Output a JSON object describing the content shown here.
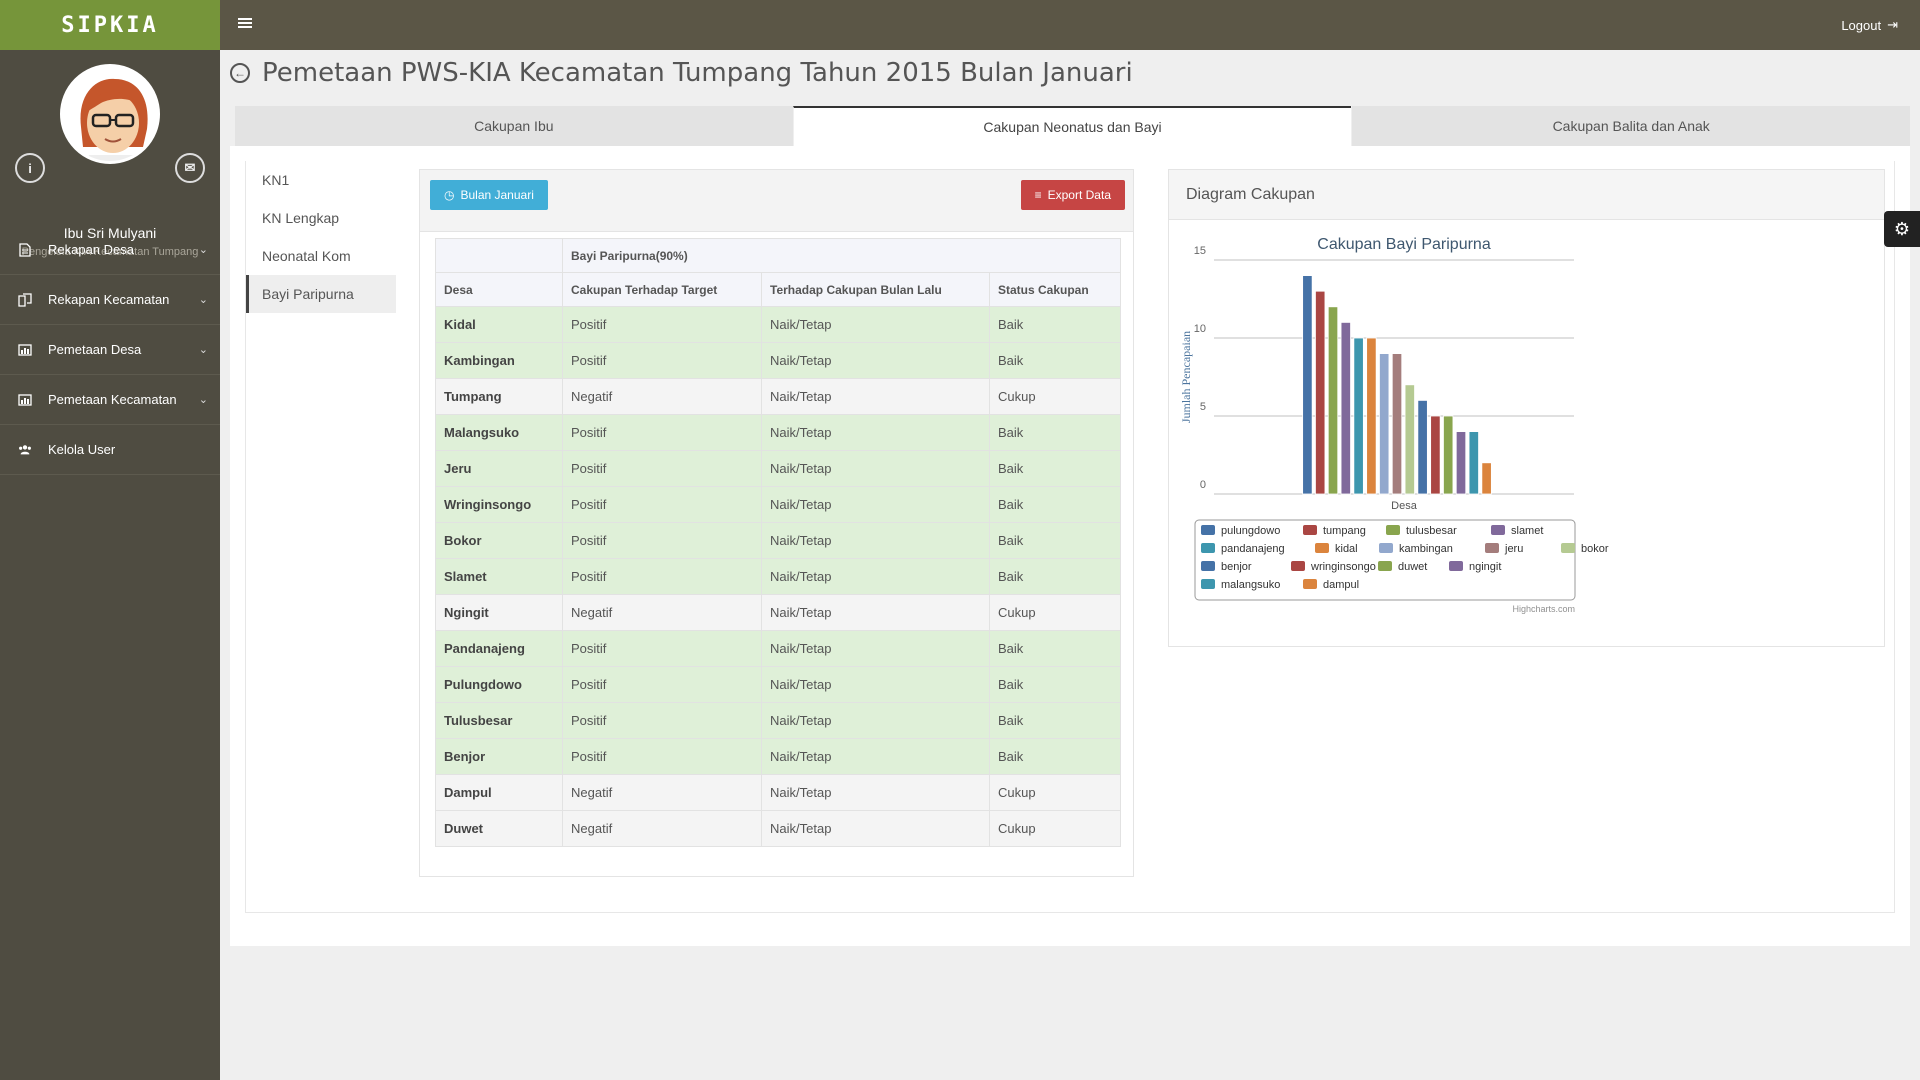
{
  "app": {
    "brand": "SIPKIA",
    "logout_label": "Logout"
  },
  "profile": {
    "name": "Ibu Sri Mulyani",
    "role": "Pengelola KIA Kecamatan Tumpang"
  },
  "menu": [
    {
      "label": "Rekapan Desa",
      "icon": "file-icon",
      "has_children": true
    },
    {
      "label": "Rekapan Kecamatan",
      "icon": "files-icon",
      "has_children": true
    },
    {
      "label": "Pemetaan Desa",
      "icon": "chart-icon",
      "has_children": true
    },
    {
      "label": "Pemetaan Kecamatan",
      "icon": "chart-icon",
      "has_children": true
    },
    {
      "label": "Kelola User",
      "icon": "users-icon",
      "has_children": false
    }
  ],
  "page": {
    "title": "Pemetaan PWS-KIA Kecamatan Tumpang Tahun 2015 Bulan Januari"
  },
  "tabs": [
    {
      "label": "Cakupan Ibu",
      "active": false
    },
    {
      "label": "Cakupan Neonatus dan Bayi",
      "active": true
    },
    {
      "label": "Cakupan Balita dan Anak",
      "active": false
    }
  ],
  "subnav": [
    {
      "label": "KN1",
      "active": false
    },
    {
      "label": "KN Lengkap",
      "active": false
    },
    {
      "label": "Neonatal Kom",
      "active": false
    },
    {
      "label": "Bayi Paripurna",
      "active": true
    }
  ],
  "toolbar": {
    "month_button": "Bulan Januari",
    "export_button": "Export Data"
  },
  "table": {
    "group_header": "Bayi Paripurna(90%)",
    "columns": [
      "Desa",
      "Cakupan Terhadap Target",
      "Terhadap Cakupan Bulan Lalu",
      "Status Cakupan"
    ],
    "rows": [
      {
        "desa": "Kidal",
        "target": "Positif",
        "bulan_lalu": "Naik/Tetap",
        "status": "Baik"
      },
      {
        "desa": "Kambingan",
        "target": "Positif",
        "bulan_lalu": "Naik/Tetap",
        "status": "Baik"
      },
      {
        "desa": "Tumpang",
        "target": "Negatif",
        "bulan_lalu": "Naik/Tetap",
        "status": "Cukup"
      },
      {
        "desa": "Malangsuko",
        "target": "Positif",
        "bulan_lalu": "Naik/Tetap",
        "status": "Baik"
      },
      {
        "desa": "Jeru",
        "target": "Positif",
        "bulan_lalu": "Naik/Tetap",
        "status": "Baik"
      },
      {
        "desa": "Wringinsongo",
        "target": "Positif",
        "bulan_lalu": "Naik/Tetap",
        "status": "Baik"
      },
      {
        "desa": "Bokor",
        "target": "Positif",
        "bulan_lalu": "Naik/Tetap",
        "status": "Baik"
      },
      {
        "desa": "Slamet",
        "target": "Positif",
        "bulan_lalu": "Naik/Tetap",
        "status": "Baik"
      },
      {
        "desa": "Ngingit",
        "target": "Negatif",
        "bulan_lalu": "Naik/Tetap",
        "status": "Cukup"
      },
      {
        "desa": "Pandanajeng",
        "target": "Positif",
        "bulan_lalu": "Naik/Tetap",
        "status": "Baik"
      },
      {
        "desa": "Pulungdowo",
        "target": "Positif",
        "bulan_lalu": "Naik/Tetap",
        "status": "Baik"
      },
      {
        "desa": "Tulusbesar",
        "target": "Positif",
        "bulan_lalu": "Naik/Tetap",
        "status": "Baik"
      },
      {
        "desa": "Benjor",
        "target": "Positif",
        "bulan_lalu": "Naik/Tetap",
        "status": "Baik"
      },
      {
        "desa": "Dampul",
        "target": "Negatif",
        "bulan_lalu": "Naik/Tetap",
        "status": "Cukup"
      },
      {
        "desa": "Duwet",
        "target": "Negatif",
        "bulan_lalu": "Naik/Tetap",
        "status": "Cukup"
      }
    ]
  },
  "chart_panel": {
    "title": "Diagram Cakupan",
    "credits": "Highcharts.com"
  },
  "chart_data": {
    "type": "bar",
    "title": "Cakupan Bayi Paripurna",
    "xlabel": "Desa",
    "ylabel": "Jumlah Pencapaian",
    "ylim": [
      0,
      15
    ],
    "yticks": [
      0,
      5,
      10,
      15
    ],
    "grid": true,
    "legend_position": "bottom",
    "series": [
      {
        "name": "pulungdowo",
        "value": 14,
        "color": "#4572a7"
      },
      {
        "name": "tumpang",
        "value": 13,
        "color": "#aa4643"
      },
      {
        "name": "tulusbesar",
        "value": 12,
        "color": "#89a54e"
      },
      {
        "name": "slamet",
        "value": 11,
        "color": "#80699b"
      },
      {
        "name": "pandanajeng",
        "value": 10,
        "color": "#3d96ae"
      },
      {
        "name": "kidal",
        "value": 10,
        "color": "#db843d"
      },
      {
        "name": "kambingan",
        "value": 9,
        "color": "#92a8cd"
      },
      {
        "name": "jeru",
        "value": 9,
        "color": "#a47d7c"
      },
      {
        "name": "bokor",
        "value": 7,
        "color": "#b5ca92"
      },
      {
        "name": "benjor",
        "value": 6,
        "color": "#4572a7"
      },
      {
        "name": "wringinsongo",
        "value": 5,
        "color": "#aa4643"
      },
      {
        "name": "duwet",
        "value": 5,
        "color": "#89a54e"
      },
      {
        "name": "ngingit",
        "value": 4,
        "color": "#80699b"
      },
      {
        "name": "malangsuko",
        "value": 4,
        "color": "#3d96ae"
      },
      {
        "name": "dampul",
        "value": 2,
        "color": "#db843d"
      }
    ]
  }
}
